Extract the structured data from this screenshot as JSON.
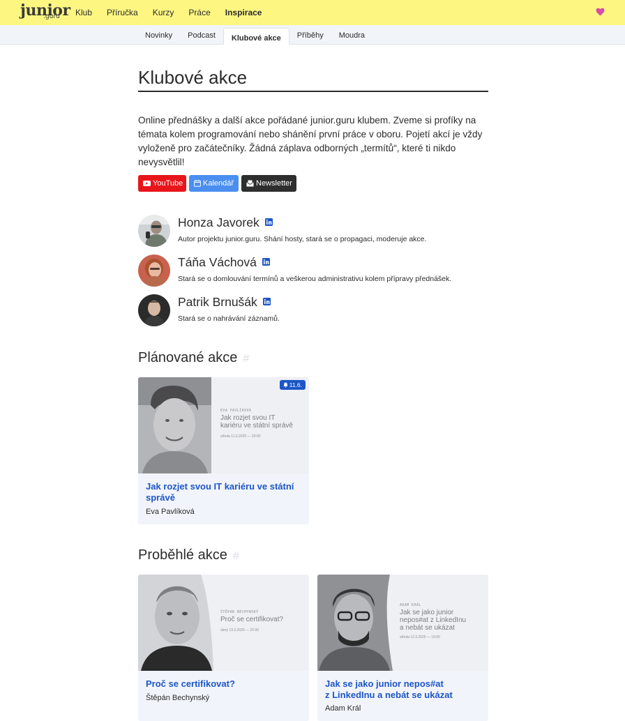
{
  "brand": {
    "logo_main": "junior",
    "logo_sub": ".guru"
  },
  "topnav": {
    "items": [
      {
        "label": "Klub"
      },
      {
        "label": "Příručka"
      },
      {
        "label": "Kurzy"
      },
      {
        "label": "Práce"
      },
      {
        "label": "Inspirace",
        "active": true
      }
    ],
    "heart_icon": "heart-icon",
    "heart_color": "#d64ea8"
  },
  "subnav": {
    "items": [
      {
        "label": "Novinky"
      },
      {
        "label": "Podcast"
      },
      {
        "label": "Klubové akce",
        "active": true
      },
      {
        "label": "Příběhy"
      },
      {
        "label": "Moudra"
      }
    ]
  },
  "page": {
    "title": "Klubové akce",
    "intro": "Online přednášky a další akce pořádané junior.guru klubem. Zveme si profíky na témata kolem programování nebo shánění první práce v oboru. Pojetí akcí je vždy vyloženě pro začátečníky. Žádná záplava odborných „termítů“, které ti nikdo nevysvětlil!"
  },
  "buttons": {
    "youtube": {
      "label": "YouTube",
      "icon": "youtube-icon",
      "color": "#e8151b"
    },
    "calendar": {
      "label": "Kalendář",
      "icon": "calendar-icon",
      "color": "#4b8ef0"
    },
    "newsletter": {
      "label": "Newsletter",
      "icon": "envelope-icon",
      "color": "#2e2e2e"
    }
  },
  "people": [
    {
      "name": "Honza Javorek",
      "desc": "Autor projektu junior.guru. Shání hosty, stará se o propagaci, moderuje akce.",
      "icon": "linkedin-icon"
    },
    {
      "name": "Táňa Váchová",
      "desc": "Stará se o domlouvání termínů a veškerou administrativu kolem přípravy přednášek.",
      "icon": "linkedin-icon"
    },
    {
      "name": "Patrik Brnušák",
      "desc": "Stará se o nahrávání záznamů.",
      "icon": "linkedin-icon"
    }
  ],
  "sections": {
    "planned": {
      "title": "Plánované akce",
      "anchor": "#"
    },
    "past": {
      "title": "Proběhlé akce",
      "anchor": "#"
    }
  },
  "planned_events": [
    {
      "title": "Jak rozjet svou IT kariéru ve státní správě",
      "author": "Eva Pavlíková",
      "badge": "11.6.",
      "badge_icon": "bell-icon",
      "poster": {
        "speaker": "EVA PAVLÍKOVÁ",
        "title_line1": "Jak rozjet svou IT",
        "title_line2": "kariéru ve státní správě",
        "date": "středa 11.6.2025 — 20:00"
      }
    }
  ],
  "past_events": [
    {
      "title": "Proč se certifikovat?",
      "author": "Štěpán Bechynský",
      "poster": {
        "speaker": "ŠTĚPÁN BECHYNSKÝ",
        "title_line1": "Proč se certifikovat?",
        "date": "úterý 13.5.2025 — 20:00"
      }
    },
    {
      "title_line1": "Jak se jako junior nepos#at",
      "title_line2": "z LinkedInu a nebát se ukázat",
      "author": "Adam Král",
      "poster": {
        "speaker": "ADAM KRÁL",
        "title_line1": "Jak se jako junior",
        "title_line2": "nepos#at z LinkedInu",
        "title_line3": "a nebát se ukázat",
        "date": "středa 12.3.2025 — 19:00"
      }
    }
  ]
}
